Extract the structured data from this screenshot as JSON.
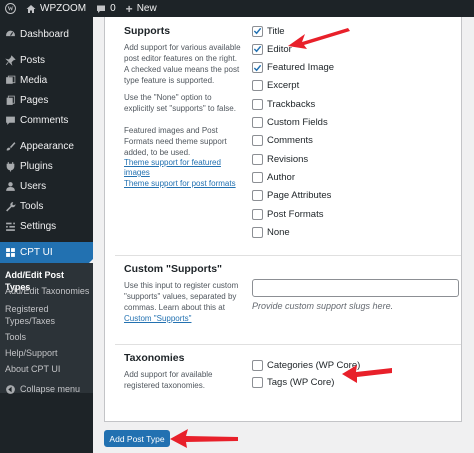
{
  "adminbar": {
    "site_name": "WPZOOM",
    "comments_count": "0",
    "new_label": "New"
  },
  "sidebar": {
    "items": [
      {
        "label": "Dashboard",
        "icon": "dashboard-icon"
      },
      {
        "label": "Posts",
        "icon": "pin-icon"
      },
      {
        "label": "Media",
        "icon": "media-icon"
      },
      {
        "label": "Pages",
        "icon": "pages-icon"
      },
      {
        "label": "Comments",
        "icon": "comment-icon"
      },
      {
        "label": "Appearance",
        "icon": "brush-icon"
      },
      {
        "label": "Plugins",
        "icon": "plugin-icon"
      },
      {
        "label": "Users",
        "icon": "user-icon"
      },
      {
        "label": "Tools",
        "icon": "wrench-icon"
      },
      {
        "label": "Settings",
        "icon": "settings-icon"
      },
      {
        "label": "CPT UI",
        "icon": "cptui-icon"
      }
    ],
    "submenu": [
      "Add/Edit Post Types",
      "Add/Edit Taxonomies",
      "Registered Types/Taxes",
      "Tools",
      "Help/Support",
      "About CPT UI"
    ],
    "collapse_label": "Collapse menu"
  },
  "supports": {
    "title": "Supports",
    "desc1": "Add support for various available post editor features on the right. A checked value means the post type feature is supported.",
    "desc2": "Use the \"None\" option to explicitly set \"supports\" to false.",
    "desc3": "Featured images and Post Formats need theme support added, to be used.",
    "link1": "Theme support for featured images",
    "link2": "Theme support for post formats",
    "options": [
      {
        "label": "Title",
        "checked": true
      },
      {
        "label": "Editor",
        "checked": true
      },
      {
        "label": "Featured Image",
        "checked": true
      },
      {
        "label": "Excerpt",
        "checked": false
      },
      {
        "label": "Trackbacks",
        "checked": false
      },
      {
        "label": "Custom Fields",
        "checked": false
      },
      {
        "label": "Comments",
        "checked": false
      },
      {
        "label": "Revisions",
        "checked": false
      },
      {
        "label": "Author",
        "checked": false
      },
      {
        "label": "Page Attributes",
        "checked": false
      },
      {
        "label": "Post Formats",
        "checked": false
      },
      {
        "label": "None",
        "checked": false
      }
    ]
  },
  "custom_supports": {
    "title": "Custom \"Supports\"",
    "desc_prefix": "Use this input to register custom \"supports\" values, separated by commas. Learn about this at ",
    "desc_link": "Custom \"Supports\"",
    "input_value": "",
    "help": "Provide custom support slugs here."
  },
  "taxonomies": {
    "title": "Taxonomies",
    "desc": "Add support for available registered taxonomies.",
    "options": [
      {
        "label": "Categories (WP Core)",
        "checked": false
      },
      {
        "label": "Tags (WP Core)",
        "checked": false
      }
    ]
  },
  "actions": {
    "add_button": "Add Post Type"
  },
  "colors": {
    "admin_dark": "#1d2327",
    "accent": "#2271b1",
    "annotation_arrow": "#e8202a"
  }
}
